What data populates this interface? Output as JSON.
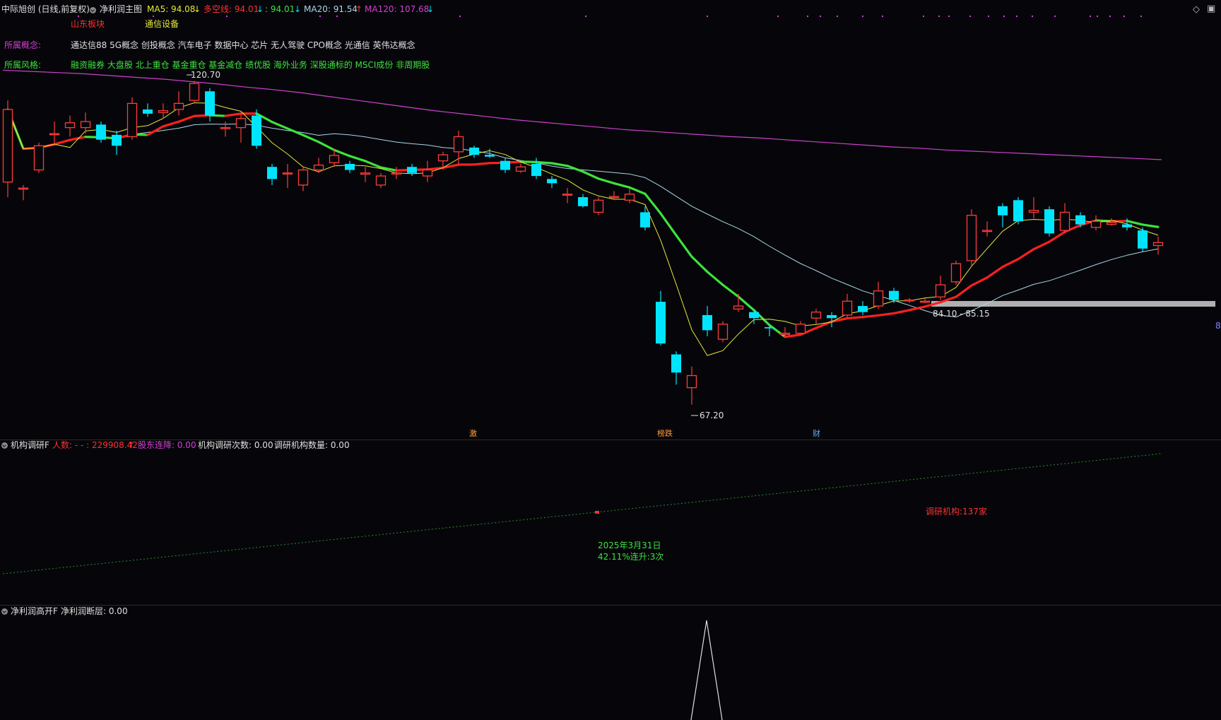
{
  "header": {
    "stock_title": "中际旭创 (日线,前复权)",
    "indicator_name": "净利润主图",
    "ma5": "MA5: 94.08",
    "ma5_arrow": "↓",
    "duokong": "多空线: 94.01",
    "duokong_arrow": "↓",
    "unknown": ": 94.01",
    "unknown_arrow": "↓",
    "ma20": "MA20: 91.54",
    "ma20_arrow": "↑",
    "ma120": "MA120: 107.68",
    "ma120_arrow": "↓"
  },
  "info": {
    "region_label": "山东板块",
    "industry_label": "通信设备",
    "concept_label": "所属概念:",
    "concept_value": "通达信88 5G概念 创投概念 汽车电子 数据中心 芯片 无人驾驶 CPO概念 光通信 英伟达概念",
    "style_label": "所属风格:",
    "style_value": "融资融券 大盘股 北上重仓 基金重仓 基金减仓 绩优股 海外业务 深股通标的 MSCI成份 非周期股"
  },
  "annotations": {
    "high_label": "120.70",
    "low_label": "67.20",
    "range_label": "84.10 - 85.15",
    "right_edge_label": "8",
    "bottom_marks": [
      "激",
      "榜跌",
      "财"
    ]
  },
  "panel2": {
    "title": "机构调研F",
    "renshu": "人数: - - : 229908.42",
    "renshu_arrow": "↑",
    "gudong": "股东连降: 0.00",
    "jigou_cishu": "机构调研次数: 0.00",
    "jigou_shuliang": "调研机构数量: 0.00",
    "note_date": "2025年3月31日",
    "note_detail": "42.11%连升:3次",
    "research_count": "调研机构:137家"
  },
  "panel3": {
    "title": "净利润高开F",
    "value": "净利润断层: 0.00"
  },
  "colors": {
    "up": "#ff3b3b",
    "down": "#00e5ff",
    "ma5": "#e8e83a",
    "ma10_thick_green": "#3ce23c",
    "ma_red": "#ff2020",
    "ma20": "#a8d8e8",
    "ma120": "#d040d0"
  },
  "chart_data": {
    "type": "candlestick",
    "title": "中际旭创 (日线,前复权)",
    "ylim": [
      64,
      123
    ],
    "candles": [
      [
        104.0,
        116.0,
        117.5,
        101.5
      ],
      [
        103.0,
        103.0,
        103.5,
        101.0
      ],
      [
        106.0,
        110.0,
        110.5,
        105.5
      ],
      [
        112.0,
        112.0,
        114.0,
        110.0
      ],
      [
        113.0,
        113.8,
        115.0,
        111.5
      ],
      [
        113.0,
        114.0,
        115.5,
        112.0
      ],
      [
        113.5,
        111.0,
        114.0,
        110.5
      ],
      [
        111.8,
        110.0,
        112.5,
        108.5
      ],
      [
        111.5,
        117.0,
        118.0,
        111.0
      ],
      [
        116.0,
        115.3,
        117.0,
        114.8
      ],
      [
        115.5,
        115.8,
        117.0,
        114.5
      ],
      [
        116.0,
        117.0,
        119.0,
        115.0
      ],
      [
        117.5,
        120.3,
        120.7,
        117.0
      ],
      [
        119.0,
        115.0,
        119.5,
        114.0
      ],
      [
        113.0,
        113.0,
        114.0,
        111.5
      ],
      [
        113.0,
        114.5,
        115.5,
        110.5
      ],
      [
        115.0,
        110.0,
        116.0,
        109.5
      ],
      [
        106.5,
        104.5,
        107.0,
        103.5
      ],
      [
        105.5,
        105.5,
        107.0,
        103.0
      ],
      [
        103.5,
        106.0,
        106.5,
        102.5
      ],
      [
        106.0,
        106.8,
        108.0,
        105.5
      ],
      [
        107.2,
        108.4,
        109.5,
        106.5
      ],
      [
        107.0,
        106.0,
        107.5,
        105.5
      ],
      [
        105.3,
        105.5,
        106.5,
        104.0
      ],
      [
        103.5,
        105.0,
        105.5,
        103.0
      ],
      [
        105.5,
        105.5,
        106.5,
        104.5
      ],
      [
        106.5,
        105.5,
        107.0,
        105.0
      ],
      [
        105.0,
        106.0,
        107.5,
        104.0
      ],
      [
        107.5,
        108.5,
        109.0,
        106.0
      ],
      [
        109.0,
        111.5,
        112.5,
        107.0
      ],
      [
        109.7,
        108.5,
        110.0,
        108.0
      ],
      [
        108.5,
        108.2,
        109.5,
        108.0
      ],
      [
        107.5,
        106.0,
        108.0,
        105.5
      ],
      [
        105.8,
        106.5,
        107.0,
        105.5
      ],
      [
        107.0,
        105.0,
        108.0,
        104.5
      ],
      [
        104.5,
        103.8,
        105.0,
        103.0
      ],
      [
        102.0,
        102.0,
        103.0,
        100.5
      ],
      [
        101.5,
        100.0,
        102.0,
        99.8
      ],
      [
        99.0,
        101.0,
        101.5,
        98.5
      ],
      [
        101.5,
        101.6,
        102.5,
        101.0
      ],
      [
        101.0,
        102.0,
        103.0,
        100.5
      ],
      [
        99.0,
        96.5,
        100.0,
        96.0
      ],
      [
        84.2,
        77.3,
        86.0,
        77.0
      ],
      [
        75.5,
        72.5,
        76.0,
        70.5
      ],
      [
        70.0,
        72.0,
        73.5,
        67.2
      ],
      [
        82.0,
        79.5,
        83.5,
        78.5
      ],
      [
        78.0,
        80.5,
        81.0,
        77.5
      ],
      [
        83.0,
        83.5,
        85.5,
        82.5
      ],
      [
        82.5,
        81.5,
        83.0,
        80.5
      ],
      [
        80.0,
        79.8,
        80.5,
        78.5
      ],
      [
        78.8,
        79.0,
        80.0,
        78.5
      ],
      [
        79.0,
        80.5,
        81.0,
        79.0
      ],
      [
        81.5,
        82.5,
        83.0,
        80.5
      ],
      [
        82.0,
        81.5,
        82.5,
        80.0
      ],
      [
        82.0,
        84.3,
        85.5,
        81.5
      ],
      [
        83.5,
        82.5,
        84.3,
        82.0
      ],
      [
        83.5,
        86.0,
        87.5,
        83.0
      ],
      [
        86.0,
        84.5,
        86.5,
        84.0
      ],
      [
        84.5,
        84.5,
        84.8,
        84.0
      ],
      [
        84.3,
        84.3,
        84.8,
        84.0
      ],
      [
        85.0,
        87.0,
        88.5,
        84.5
      ],
      [
        87.5,
        90.5,
        91.0,
        87.0
      ],
      [
        91.0,
        98.5,
        99.5,
        90.0
      ],
      [
        96.0,
        96.0,
        97.5,
        95.0
      ],
      [
        100.0,
        98.5,
        100.5,
        96.5
      ],
      [
        101.0,
        97.5,
        101.5,
        97.0
      ],
      [
        99.0,
        99.3,
        101.5,
        98.0
      ],
      [
        99.5,
        95.5,
        100.0,
        95.0
      ],
      [
        96.0,
        99.0,
        100.5,
        95.5
      ],
      [
        98.5,
        97.0,
        99.0,
        96.5
      ],
      [
        96.5,
        97.5,
        98.5,
        96.0
      ],
      [
        97.0,
        97.3,
        98.0,
        96.8
      ],
      [
        97.0,
        96.5,
        98.0,
        96.0
      ],
      [
        96.0,
        93.0,
        96.5,
        92.5
      ],
      [
        93.5,
        94.0,
        95.0,
        92.0
      ]
    ],
    "ma_lines": {
      "ma120": [
        122.5,
        122.3,
        122.1,
        121.9,
        121.6,
        121.3,
        121.0,
        120.6,
        120.2,
        119.7,
        119.3,
        118.8,
        118.2,
        117.6,
        117.0,
        116.4,
        115.8,
        115.3,
        114.8,
        114.3,
        113.9,
        113.5,
        113.1,
        112.7,
        112.4,
        112.1,
        111.8,
        111.5,
        111.3,
        111.0,
        110.7,
        110.4,
        110.1,
        109.8,
        109.6,
        109.3,
        109.1,
        108.9,
        108.7,
        108.5,
        108.3,
        108.1,
        107.9,
        107.7
      ],
      "note": "MA lines are smoothed moving averages drawn over the candle series"
    }
  }
}
